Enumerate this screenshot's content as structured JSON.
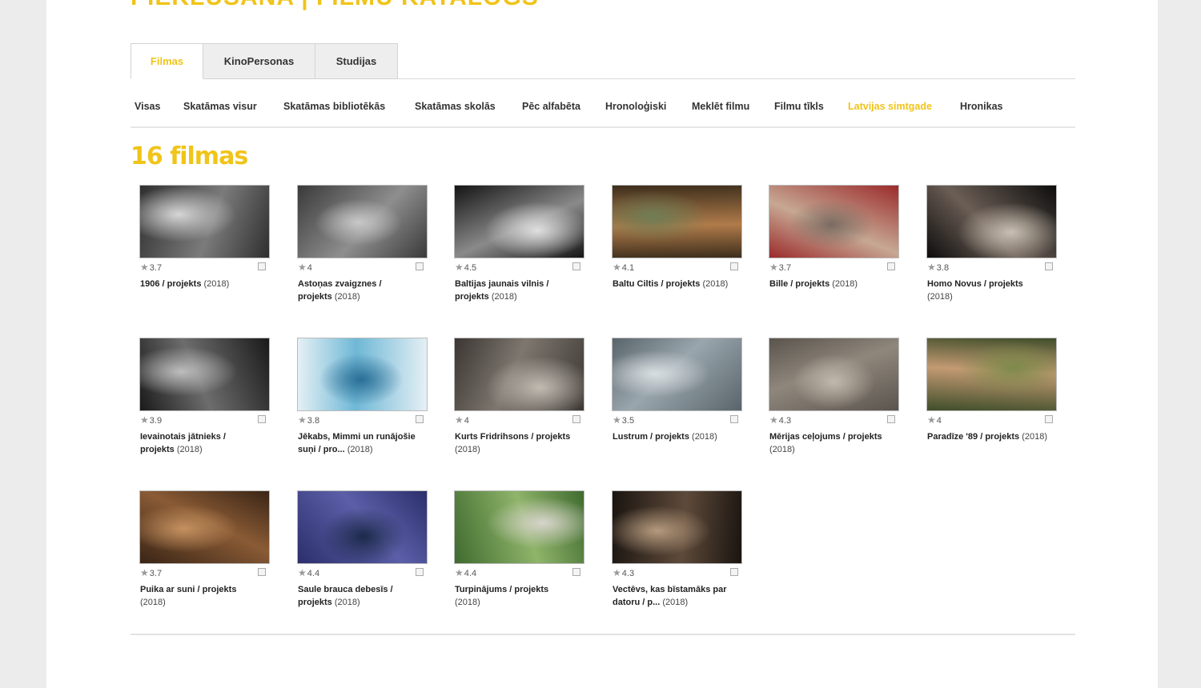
{
  "header": {
    "title": "PIEKLŪSANA | FILMU KATALOGS"
  },
  "tabs": [
    {
      "label": "Filmas",
      "active": true
    },
    {
      "label": "KinoPersonas",
      "active": false
    },
    {
      "label": "Studijas",
      "active": false
    }
  ],
  "subnav": [
    {
      "label": "Visas",
      "active": false
    },
    {
      "label": "Skatāmas visur",
      "active": false
    },
    {
      "label": "Skatāmas bibliotēkās",
      "active": false
    },
    {
      "label": "Skatāmas skolās",
      "active": false
    },
    {
      "label": "Pēc alfabēta",
      "active": false
    },
    {
      "label": "Hronoloģiski",
      "active": false
    },
    {
      "label": "Meklēt filmu",
      "active": false
    },
    {
      "label": "Filmu tīkls",
      "active": false
    },
    {
      "label": "Latvijas simtgade",
      "active": true
    },
    {
      "label": "Hronikas",
      "active": false
    }
  ],
  "count_label": "16 filmas",
  "films": [
    {
      "rating": "3.7",
      "title": "1906 / projekts",
      "year": "(2018)",
      "icon": "film-still-1906",
      "palette": [
        "#2f2f2f",
        "#7b7b7b",
        "#d6d6d6"
      ]
    },
    {
      "rating": "4",
      "title": "Astoņas zvaigznes / projekts",
      "year": "(2018)",
      "icon": "film-still-astonas",
      "palette": [
        "#3a3a3a",
        "#8e8e8e",
        "#c8c8c8"
      ]
    },
    {
      "rating": "4.5",
      "title": "Baltijas jaunais vilnis / projekts",
      "year": "(2018)",
      "icon": "film-still-baltijas",
      "palette": [
        "#141414",
        "#8a8a8a",
        "#e0e0e0"
      ]
    },
    {
      "rating": "4.1",
      "title": "Baltu Ciltis / projekts",
      "year": "(2018)",
      "icon": "film-still-baltu",
      "palette": [
        "#3d2e1c",
        "#b07b4a",
        "#6f7d54"
      ]
    },
    {
      "rating": "3.7",
      "title": "Bille / projekts",
      "year": "(2018)",
      "icon": "film-still-bille",
      "palette": [
        "#9b2b2b",
        "#c7a893",
        "#7a6a60"
      ]
    },
    {
      "rating": "3.8",
      "title": "Homo Novus / projekts",
      "year": "(2018)",
      "icon": "film-still-homo-novus",
      "palette": [
        "#0d0d0d",
        "#6b5e55",
        "#c9bfb2"
      ]
    },
    {
      "rating": "3.9",
      "title": "Ievainotais jātnieks / projekts",
      "year": "(2018)",
      "icon": "film-still-ievainotais",
      "palette": [
        "#1a1a1a",
        "#6d6d6d",
        "#bdbdbd"
      ]
    },
    {
      "rating": "3.8",
      "title": "Jēkabs, Mimmi un runājošie suņi / pro...",
      "year": "(2018)",
      "icon": "film-still-jekabs",
      "palette": [
        "#e6f0f5",
        "#6fb8d6",
        "#2a6f96"
      ]
    },
    {
      "rating": "4",
      "title": "Kurts Fridrihsons / projekts",
      "year": "(2018)",
      "icon": "film-still-kurts",
      "palette": [
        "#3b3633",
        "#7e776f",
        "#c2bbb2"
      ]
    },
    {
      "rating": "3.5",
      "title": "Lustrum / projekts",
      "year": "(2018)",
      "icon": "film-still-lustrum",
      "palette": [
        "#59646b",
        "#9aa6ad",
        "#d9dee0"
      ]
    },
    {
      "rating": "4.3",
      "title": "Mērijas ceļojums / projekts",
      "year": "(2018)",
      "icon": "film-still-merijas",
      "palette": [
        "#5a544d",
        "#8f877c",
        "#c2b9ad"
      ]
    },
    {
      "rating": "4",
      "title": "Paradīze '89 / projekts",
      "year": "(2018)",
      "icon": "film-still-paradize",
      "palette": [
        "#3f4e2a",
        "#c39a73",
        "#7c8a4a"
      ]
    },
    {
      "rating": "3.7",
      "title": "Puika ar suni / projekts",
      "year": "(2018)",
      "icon": "film-still-puika",
      "palette": [
        "#3a2516",
        "#8a5b35",
        "#c49160"
      ]
    },
    {
      "rating": "4.4",
      "title": "Saule brauca debesīs / projekts",
      "year": "(2018)",
      "icon": "film-still-saule",
      "palette": [
        "#2b2f6b",
        "#5c5fa8",
        "#1c2a4a"
      ]
    },
    {
      "rating": "4.4",
      "title": "Turpinājums / projekts",
      "year": "(2018)",
      "icon": "film-still-turpinajums",
      "palette": [
        "#3f6b2f",
        "#8fb46a",
        "#d8d4cc"
      ]
    },
    {
      "rating": "4.3",
      "title": "Vectēvs, kas bīstamāks par datoru / p...",
      "year": "(2018)",
      "icon": "film-still-vectevs",
      "palette": [
        "#1a1410",
        "#5e4a3a",
        "#b59a7d"
      ]
    }
  ]
}
